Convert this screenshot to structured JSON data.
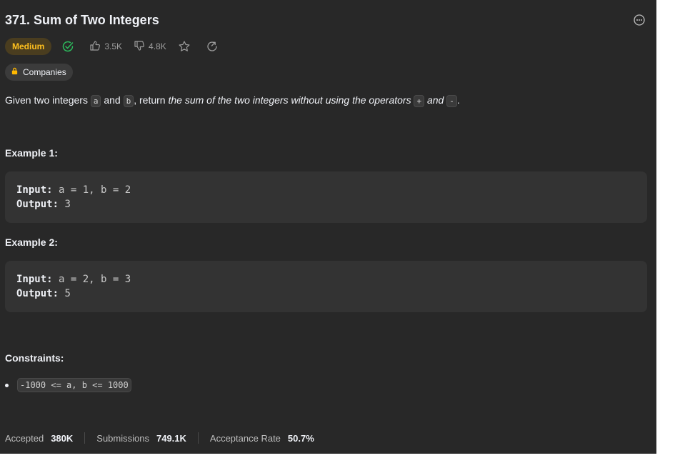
{
  "problem": {
    "title": "371. Sum of Two Integers",
    "difficulty": "Medium",
    "likes": "3.5K",
    "dislikes": "4.8K",
    "companies_label": "Companies"
  },
  "description": {
    "p1": "Given two integers ",
    "var_a": "a",
    "p2": " and ",
    "var_b": "b",
    "p3": ", return ",
    "p4": "the sum of the two integers without using the operators ",
    "op_plus": "+",
    "p5": " and ",
    "op_minus": "-",
    "p6": "."
  },
  "examples": [
    {
      "heading": "Example 1:",
      "input_label": "Input:",
      "input": " a = 1, b = 2",
      "output_label": "Output:",
      "output": " 3"
    },
    {
      "heading": "Example 2:",
      "input_label": "Input:",
      "input": " a = 2, b = 3",
      "output_label": "Output:",
      "output": " 5"
    }
  ],
  "constraints": {
    "heading": "Constraints:",
    "items": [
      "-1000 <= a, b <= 1000"
    ]
  },
  "stats": {
    "accepted_label": "Accepted",
    "accepted_value": "380K",
    "submissions_label": "Submissions",
    "submissions_value": "749.1K",
    "rate_label": "Acceptance Rate",
    "rate_value": "50.7%"
  },
  "colors": {
    "background": "#282828",
    "difficulty_medium": "#ffc01e",
    "solved_green": "#2cbb5d"
  },
  "icons": [
    "more-icon",
    "solved-check-icon",
    "thumbs-up-icon",
    "thumbs-down-icon",
    "star-icon",
    "share-icon",
    "lock-icon"
  ]
}
